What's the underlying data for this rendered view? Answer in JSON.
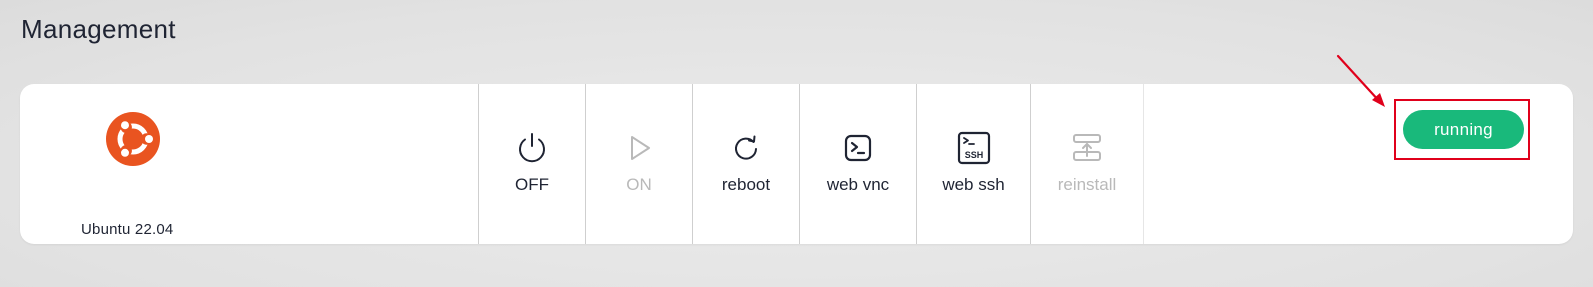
{
  "page": {
    "title": "Management"
  },
  "server": {
    "os_name": "Ubuntu 22.04",
    "os_icon": "ubuntu-logo-icon",
    "status": "running"
  },
  "actions": [
    {
      "label": "OFF",
      "icon": "power-icon",
      "enabled": true
    },
    {
      "label": "ON",
      "icon": "play-icon",
      "enabled": false
    },
    {
      "label": "reboot",
      "icon": "refresh-icon",
      "enabled": true
    },
    {
      "label": "web vnc",
      "icon": "terminal-icon",
      "enabled": true
    },
    {
      "label": "web ssh",
      "icon": "ssh-icon",
      "enabled": true
    },
    {
      "label": "reinstall",
      "icon": "upload-icon",
      "enabled": false
    }
  ],
  "colors": {
    "status_green": "#19b97b",
    "highlight_red": "#e0001b",
    "ubuntu_orange": "#e95420",
    "text_dark": "#1f2433",
    "text_disabled": "#b9b9b9"
  }
}
